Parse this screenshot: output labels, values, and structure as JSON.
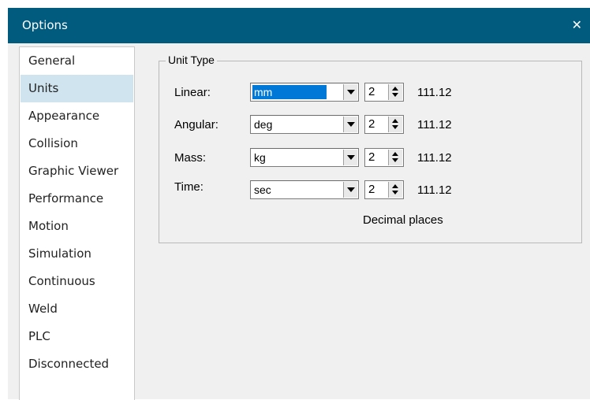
{
  "window": {
    "title": "Options",
    "close_symbol": "✕"
  },
  "sidebar": {
    "items": [
      {
        "label": "General"
      },
      {
        "label": "Units",
        "selected": true
      },
      {
        "label": "Appearance"
      },
      {
        "label": "Collision"
      },
      {
        "label": "Graphic Viewer"
      },
      {
        "label": "Performance"
      },
      {
        "label": "Motion"
      },
      {
        "label": "Simulation"
      },
      {
        "label": "Continuous"
      },
      {
        "label": "Weld"
      },
      {
        "label": "PLC"
      },
      {
        "label": "Disconnected"
      }
    ]
  },
  "units": {
    "group_title": "Unit Type",
    "rows": [
      {
        "label": "Linear:",
        "unit": "mm",
        "decimals": "2",
        "sample": "111.12"
      },
      {
        "label": "Angular:",
        "unit": "deg",
        "decimals": "2",
        "sample": "111.12"
      },
      {
        "label": "Mass:",
        "unit": "kg",
        "decimals": "2",
        "sample": "111.12"
      },
      {
        "label": "Time:",
        "unit": "sec",
        "decimals": "2",
        "sample": "111.12"
      }
    ],
    "decimal_places_label": "Decimal places"
  },
  "colors": {
    "titlebar": "#005b7f",
    "selected_item": "#cfe4ee",
    "selection_highlight": "#0078d7",
    "panel_bg": "#f0f0f0"
  }
}
